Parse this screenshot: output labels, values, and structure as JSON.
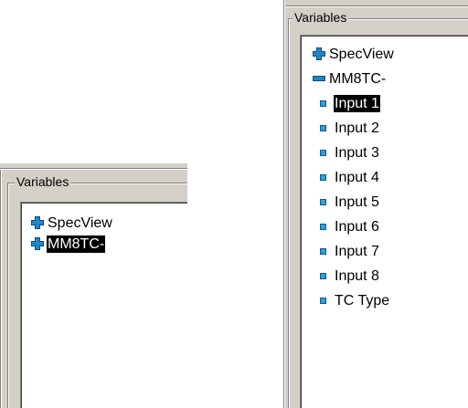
{
  "collapsed_view": {
    "group_title": "Variables",
    "nodes": [
      {
        "label": "SpecView"
      },
      {
        "label": "MM8TC-"
      }
    ]
  },
  "expanded_view": {
    "group_title": "Variables",
    "nodes": [
      {
        "label": "SpecView"
      },
      {
        "label": "MM8TC-"
      }
    ],
    "children": [
      {
        "label": "Input 1"
      },
      {
        "label": "Input 2"
      },
      {
        "label": "Input 3"
      },
      {
        "label": "Input 4"
      },
      {
        "label": "Input 5"
      },
      {
        "label": "Input 6"
      },
      {
        "label": "Input 7"
      },
      {
        "label": "Input 8"
      },
      {
        "label": "TC Type"
      }
    ]
  },
  "colors": {
    "panel": "#d4d0c8",
    "tree_bg": "#ffffff",
    "expander_icon": "#1f87c8",
    "leaf_bullet": "#2fa0d8",
    "selection": "#000000"
  }
}
